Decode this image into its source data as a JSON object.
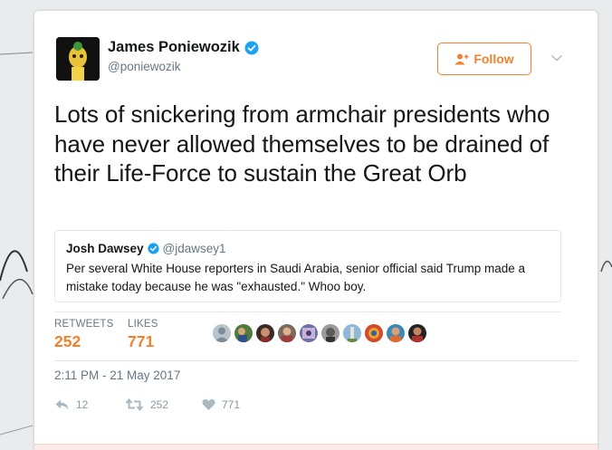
{
  "tweet": {
    "author": {
      "name": "James Poniewozik",
      "handle": "@poniewozik",
      "verified": true
    },
    "follow_label": "Follow",
    "text": "Lots of snickering from armchair presidents who have never allowed themselves to be drained of their Life-Force to sustain the Great Orb",
    "quoted": {
      "name": "Josh Dawsey",
      "handle": "@jdawsey1",
      "verified": true,
      "text": "Per several White House reporters in Saudi Arabia, senior official said Trump made a mistake today because he was \"exhausted.\" Whoo boy."
    },
    "stats": {
      "retweets_label": "RETWEETS",
      "retweets": "252",
      "likes_label": "LIKES",
      "likes": "771"
    },
    "liker_avatar_count": 10,
    "timestamp": "2:11 PM - 21 May 2017",
    "actions": {
      "replies": "12",
      "retweets": "252",
      "likes": "771"
    }
  },
  "colors": {
    "accent": "#f4802f",
    "verified": "#1da1f2",
    "text": "#14171a",
    "muted": "#657786"
  },
  "icons": [
    "verified-badge-icon",
    "add-user-icon",
    "chevron-down-icon",
    "reply-icon",
    "retweet-icon",
    "heart-icon"
  ]
}
